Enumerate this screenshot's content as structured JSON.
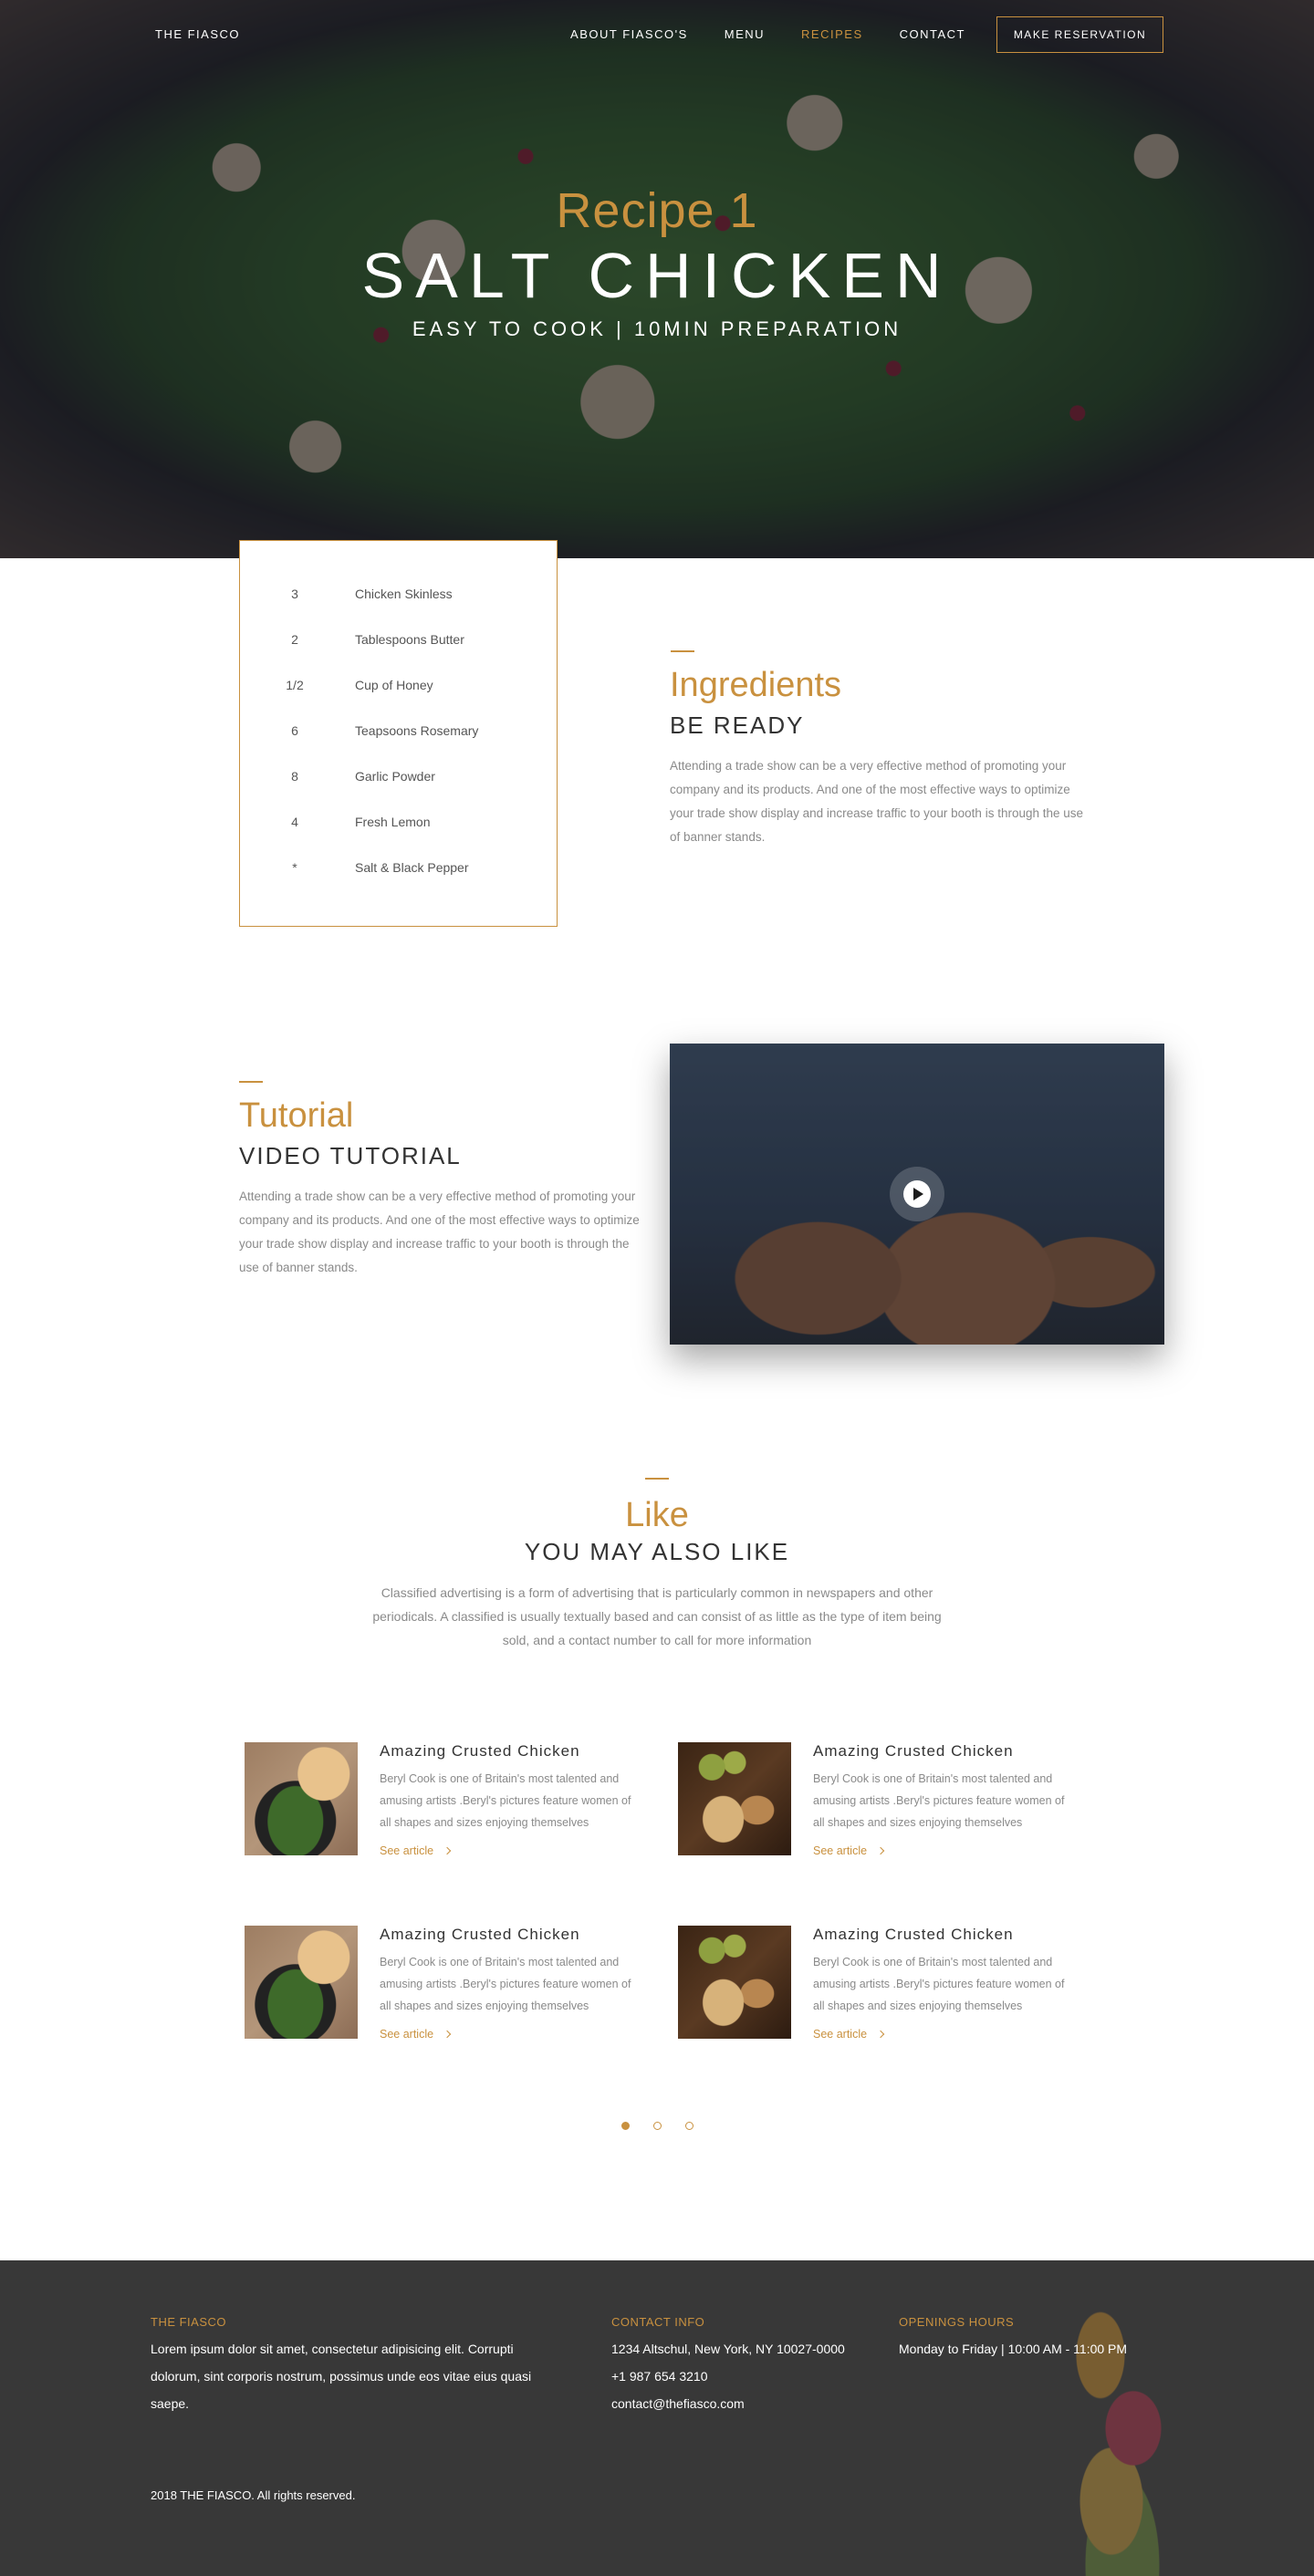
{
  "nav": {
    "brand": "THE FIASCO",
    "links": [
      "ABOUT FIASCO'S",
      "MENU",
      "RECIPES",
      "CONTACT"
    ],
    "active_link": "RECIPES",
    "reserve_label": "MAKE RESERVATION"
  },
  "hero": {
    "kicker": "Recipe 1",
    "title": "SALT CHICKEN",
    "subtitle": "EASY TO COOK | 10MIN PREPARATION"
  },
  "ingredients": {
    "items": [
      {
        "qty": "3",
        "name": "Chicken Skinless"
      },
      {
        "qty": "2",
        "name": "Tablespoons Butter"
      },
      {
        "qty": "1/2",
        "name": "Cup of Honey"
      },
      {
        "qty": "6",
        "name": "Teapsoons Rosemary"
      },
      {
        "qty": "8",
        "name": "Garlic Powder"
      },
      {
        "qty": "4",
        "name": "Fresh Lemon"
      },
      {
        "qty": "*",
        "name": "Salt & Black Pepper"
      }
    ],
    "kicker": "Ingredients",
    "title": "BE READY",
    "desc": "Attending a trade show can be a very effective method of promoting your company and its products. And one of the most effective ways to optimize your trade show display and increase traffic to your booth is through the use of banner stands."
  },
  "tutorial": {
    "kicker": "Tutorial",
    "title": "VIDEO TUTORIAL",
    "desc": "Attending a trade show can be a very effective method of promoting your company and its products. And one of the most effective ways to optimize your trade show display and increase traffic to your booth is through the use of banner stands."
  },
  "like": {
    "kicker": "Like",
    "title": "YOU MAY ALSO LIKE",
    "desc": "Classified advertising is a form of advertising that is particularly common in newspapers and other periodicals. A classified is usually textually based and can consist of as little as the type of item being sold, and a contact number to call for more information",
    "cards": [
      {
        "title": "Amazing Crusted Chicken",
        "desc": "Beryl Cook is one of Britain's most talented and amusing artists .Beryl's pictures feature women of all shapes and sizes enjoying themselves",
        "link": "See article",
        "image": "skillet-dish"
      },
      {
        "title": "Amazing Crusted Chicken",
        "desc": "Beryl Cook is one of Britain's most talented and amusing artists .Beryl's pictures feature women of all shapes and sizes enjoying themselves",
        "link": "See article",
        "image": "cheese-board"
      },
      {
        "title": "Amazing Crusted Chicken",
        "desc": "Beryl Cook is one of Britain's most talented and amusing artists .Beryl's pictures feature women of all shapes and sizes enjoying themselves",
        "link": "See article",
        "image": "skillet-dish"
      },
      {
        "title": "Amazing Crusted Chicken",
        "desc": "Beryl Cook is one of Britain's most talented and amusing artists .Beryl's pictures feature women of all shapes and sizes enjoying themselves",
        "link": "See article",
        "image": "cheese-board"
      }
    ],
    "pagination": {
      "pages": 3,
      "current": 1
    }
  },
  "footer": {
    "about_head": "THE FIASCO",
    "about_text": "Lorem ipsum dolor sit amet, consectetur adipisicing elit. Corrupti dolorum, sint corporis nostrum, possimus unde eos vitae eius quasi saepe.",
    "contact_head": "CONTACT INFO",
    "address": "1234 Altschul, New York, NY 10027-0000",
    "phone": "+1 987 654 3210",
    "email": "contact@thefiasco.com",
    "hours_head": "OPENINGS HOURS",
    "hours": "Monday to Friday | 10:00 AM - 11:00 PM",
    "copyright": "2018 THE FIASCO. All rights reserved."
  },
  "colors": {
    "accent": "#c9913f",
    "footer_bg": "#383838",
    "text": "#333333",
    "muted": "#8a8a8a"
  }
}
